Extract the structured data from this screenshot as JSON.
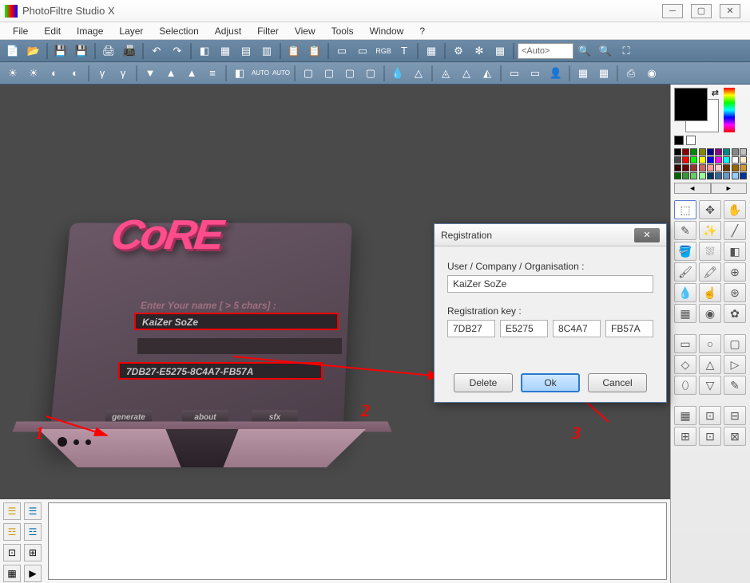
{
  "window": {
    "title": "PhotoFiltre Studio X"
  },
  "menu": [
    "File",
    "Edit",
    "Image",
    "Layer",
    "Selection",
    "Adjust",
    "Filter",
    "View",
    "Tools",
    "Window",
    "?"
  ],
  "toolbar1_zoom": "<Auto>",
  "keygen": {
    "logo": "CoRE",
    "prompt": "Enter Your name [ > 5 chars] :",
    "name": "KaiZer SoZe",
    "key": "7DB27-E5275-8C4A7-FB57A",
    "btn_generate": "generate",
    "btn_about": "about",
    "btn_sfx": "sfx"
  },
  "dialog": {
    "title": "Registration",
    "user_label": "User / Company / Organisation :",
    "user_value": "KaiZer SoZe",
    "key_label": "Registration key :",
    "key1": "7DB27",
    "key2": "E5275",
    "key3": "8C4A7",
    "key4": "FB57A",
    "btn_delete": "Delete",
    "btn_ok": "Ok",
    "btn_cancel": "Cancel"
  },
  "annot": {
    "n1": "1",
    "n2": "2",
    "n3": "3"
  },
  "palette_colors": [
    "#000",
    "#800",
    "#080",
    "#880",
    "#008",
    "#808",
    "#088",
    "#888",
    "#c0c0c0",
    "#444",
    "#f00",
    "#0f0",
    "#ff0",
    "#00f",
    "#f0f",
    "#0ff",
    "#fff",
    "#fec",
    "#300",
    "#600",
    "#933",
    "#c66",
    "#f99",
    "#fcc",
    "#630",
    "#960",
    "#c93",
    "#060",
    "#393",
    "#6c6",
    "#9f9",
    "#036",
    "#369",
    "#69c",
    "#9cf",
    "#039"
  ]
}
